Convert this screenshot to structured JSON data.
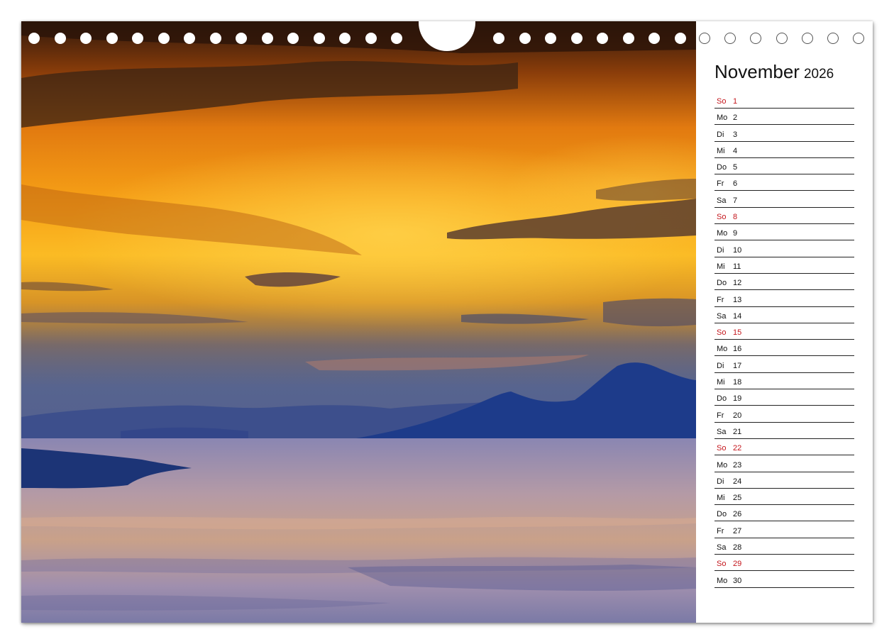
{
  "calendar": {
    "month": "November",
    "year": "2026",
    "sunday_color": "#c4161c",
    "days": [
      {
        "weekday": "So",
        "day": "1",
        "sunday": true
      },
      {
        "weekday": "Mo",
        "day": "2"
      },
      {
        "weekday": "Di",
        "day": "3"
      },
      {
        "weekday": "Mi",
        "day": "4"
      },
      {
        "weekday": "Do",
        "day": "5"
      },
      {
        "weekday": "Fr",
        "day": "6"
      },
      {
        "weekday": "Sa",
        "day": "7"
      },
      {
        "weekday": "So",
        "day": "8",
        "sunday": true
      },
      {
        "weekday": "Mo",
        "day": "9"
      },
      {
        "weekday": "Di",
        "day": "10"
      },
      {
        "weekday": "Mi",
        "day": "11"
      },
      {
        "weekday": "Do",
        "day": "12"
      },
      {
        "weekday": "Fr",
        "day": "13"
      },
      {
        "weekday": "Sa",
        "day": "14"
      },
      {
        "weekday": "So",
        "day": "15",
        "sunday": true
      },
      {
        "weekday": "Mo",
        "day": "16"
      },
      {
        "weekday": "Di",
        "day": "17"
      },
      {
        "weekday": "Mi",
        "day": "18"
      },
      {
        "weekday": "Do",
        "day": "19"
      },
      {
        "weekday": "Fr",
        "day": "20"
      },
      {
        "weekday": "Sa",
        "day": "21"
      },
      {
        "weekday": "So",
        "day": "22",
        "sunday": true
      },
      {
        "weekday": "Mo",
        "day": "23"
      },
      {
        "weekday": "Di",
        "day": "24"
      },
      {
        "weekday": "Mi",
        "day": "25"
      },
      {
        "weekday": "Do",
        "day": "26"
      },
      {
        "weekday": "Fr",
        "day": "27"
      },
      {
        "weekday": "Sa",
        "day": "28"
      },
      {
        "weekday": "So",
        "day": "29",
        "sunday": true
      },
      {
        "weekday": "Mo",
        "day": "30"
      }
    ]
  },
  "photo": {
    "sky_colors": [
      "#3a1e0f",
      "#b3520c",
      "#f08a14",
      "#fbb41c",
      "#e8a020",
      "#8a6a55",
      "#4c5e86"
    ],
    "mountain_color": "#1c3a86",
    "water_colors": [
      "#8d8ab5",
      "#c7a090",
      "#a28fb0",
      "#6d6f9f"
    ]
  }
}
